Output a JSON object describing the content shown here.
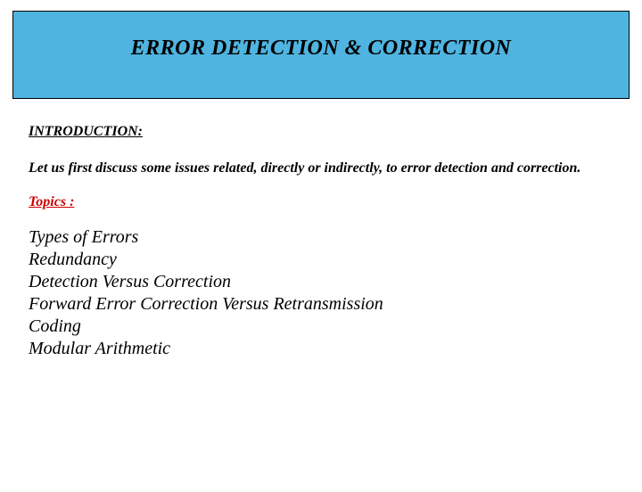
{
  "header": {
    "title": "ERROR  DETECTION & CORRECTION"
  },
  "intro": {
    "heading": "INTRODUCTION:",
    "text": "Let us first discuss some issues related, directly or indirectly, to error detection and correction."
  },
  "topics": {
    "heading": "Topics :",
    "items": [
      "Types of Errors",
      "Redundancy",
      "Detection Versus Correction",
      "Forward Error Correction Versus Retransmission",
      "Coding",
      "Modular Arithmetic"
    ]
  }
}
